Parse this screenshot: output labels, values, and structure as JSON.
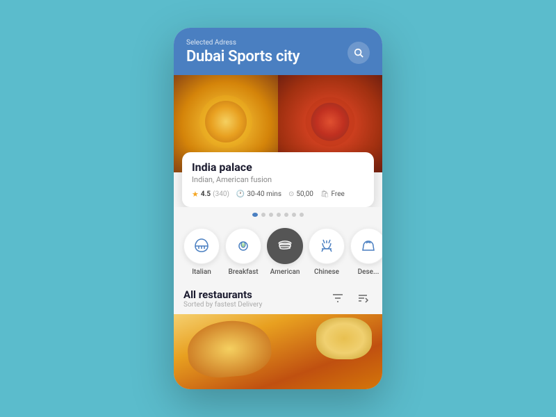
{
  "header": {
    "selected_address_label": "Selected Adress",
    "city_name": "Dubai Sports city",
    "search_button_label": "Search"
  },
  "carousel": {
    "dots": [
      true,
      false,
      false,
      false,
      false,
      false,
      false
    ],
    "restaurant": {
      "name": "India palace",
      "cuisine": "Indian, American fusion",
      "rating": "4.5",
      "rating_count": "(340)",
      "delivery_time": "30-40 mins",
      "min_order": "50,00",
      "delivery_fee": "Free"
    }
  },
  "categories": [
    {
      "label": "Italian",
      "icon": "🍕",
      "active": false
    },
    {
      "label": "Breakfast",
      "icon": "🥑",
      "active": false
    },
    {
      "label": "American",
      "icon": "🍔",
      "active": true
    },
    {
      "label": "Chinese",
      "icon": "🍜",
      "active": false
    },
    {
      "label": "Dessert",
      "icon": "🍰",
      "active": false
    }
  ],
  "restaurants_section": {
    "title": "All restaurants",
    "subtitle": "Sorted by fastest Delivery"
  }
}
